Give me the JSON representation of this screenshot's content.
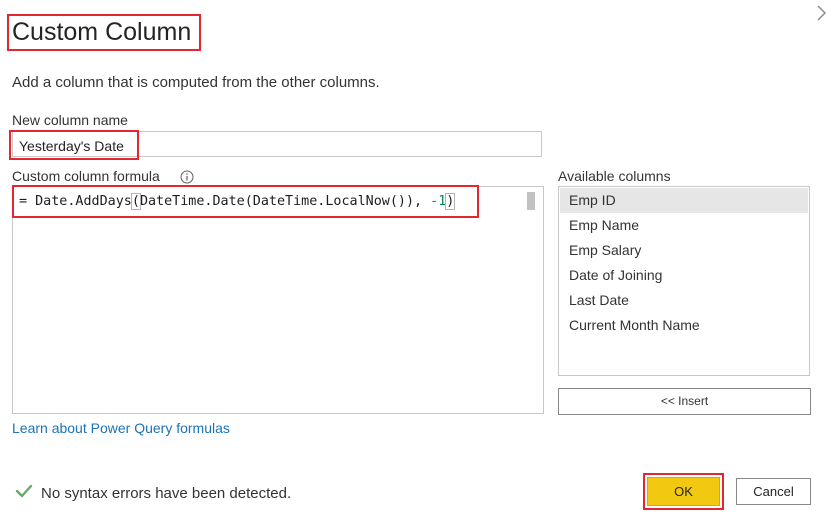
{
  "dialog": {
    "title": "Custom Column",
    "description": "Add a column that is computed from the other columns."
  },
  "new_column": {
    "label": "New column name",
    "value": "Yesterday's Date"
  },
  "formula": {
    "label": "Custom column formula",
    "parts": {
      "p1": "= Date.AddDays",
      "p2": "(",
      "p3": "DateTime.Date(DateTime.LocalNow()), ",
      "p4": "-1",
      "p5": ")"
    }
  },
  "available_columns": {
    "label": "Available columns",
    "items": [
      "Emp ID",
      "Emp Name",
      "Emp Salary",
      "Date of Joining",
      "Last Date",
      "Current Month Name"
    ],
    "selected": "Emp ID"
  },
  "insert_label": "<< Insert",
  "learn_link": "Learn about Power Query formulas",
  "status": {
    "text": "No syntax errors have been detected.",
    "icon": "checkmark-icon",
    "color": "#6aa86a"
  },
  "buttons": {
    "ok": "OK",
    "cancel": "Cancel"
  },
  "colors": {
    "highlight": "#e3262f",
    "ok_button": "#f2c811",
    "link": "#1a73b8"
  }
}
